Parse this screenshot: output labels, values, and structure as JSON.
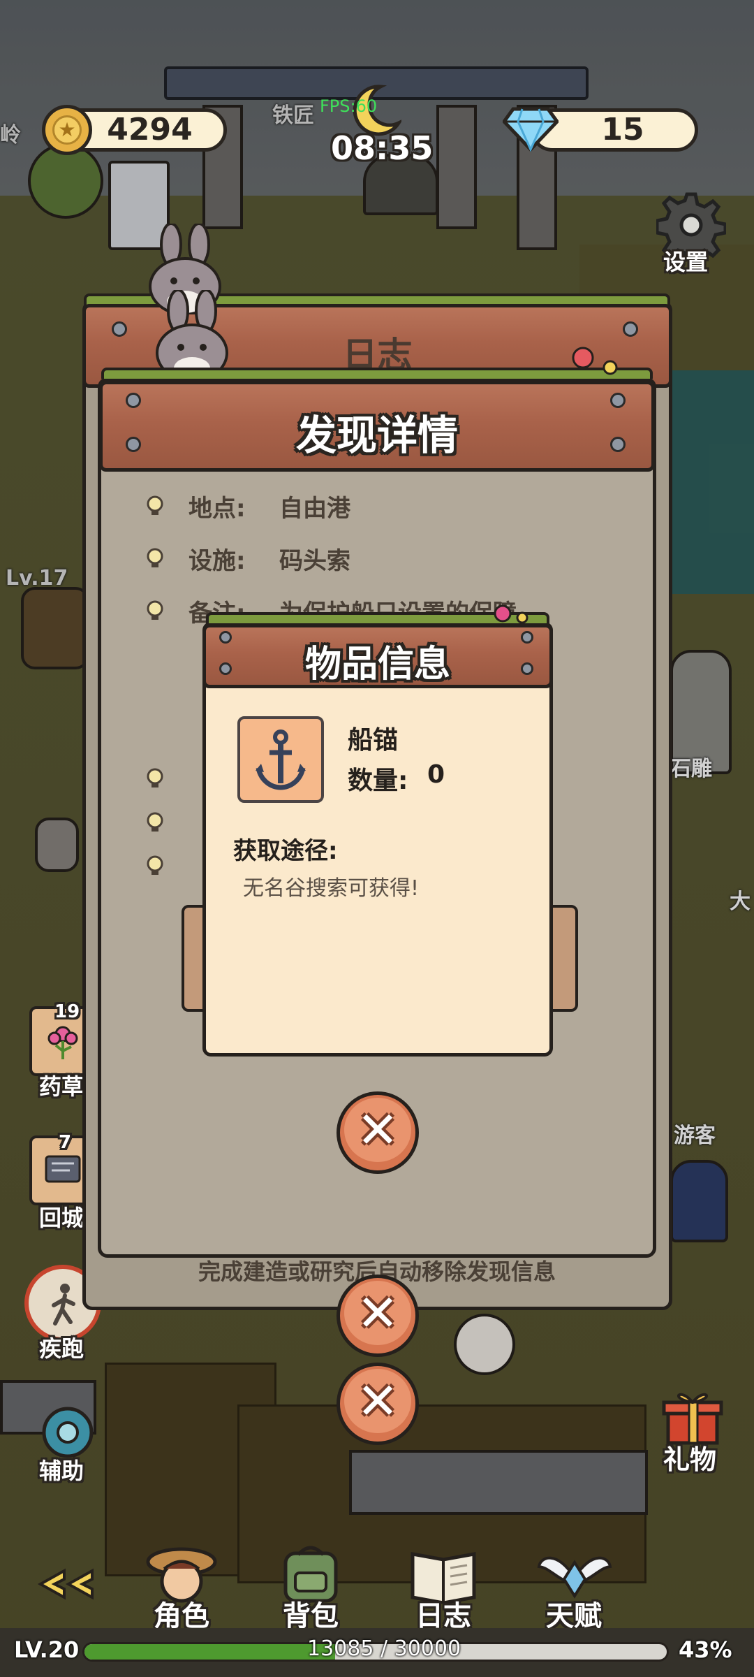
{
  "hud": {
    "coins": "4294",
    "gems": "15",
    "time": "08:35",
    "fps": "FPS:60",
    "settings_label": "设置"
  },
  "world_labels": {
    "blacksmith": "铁匠",
    "ridge": "岭",
    "statue": "石雕",
    "tourist": "游客",
    "big": "大",
    "level_label": "Lv.17"
  },
  "left_side": {
    "herb_count": "19",
    "herb_label": "药草",
    "return_count": "7",
    "return_label": "回城",
    "run_label": "疾跑",
    "assist_label": "辅助"
  },
  "right_side": {
    "gift_label": "礼物"
  },
  "journal_panel": {
    "title": "日志"
  },
  "discovery_panel": {
    "title": "发现详情",
    "rows": [
      {
        "label": "地点:",
        "value": "自由港"
      },
      {
        "label": "设施:",
        "value": "码头索"
      },
      {
        "label": "备注:",
        "value": "为保护船只设置的保障"
      }
    ],
    "footer": "完成建造或研究后自动移除发现信息"
  },
  "item_modal": {
    "title": "物品信息",
    "item_name": "船锚",
    "quantity_label": "数量:",
    "quantity_value": "0",
    "source_label": "获取途径:",
    "source_text": "无名谷搜索可获得!",
    "icon": "anchor-icon"
  },
  "bottom_nav": {
    "items": [
      {
        "label": "角色",
        "icon": "character-icon"
      },
      {
        "label": "背包",
        "icon": "backpack-icon"
      },
      {
        "label": "日志",
        "icon": "journal-book-icon"
      },
      {
        "label": "天赋",
        "icon": "talent-wings-icon"
      }
    ],
    "back_icon": "double-chevron-left-icon"
  },
  "xp_bar": {
    "level": "LV.20",
    "progress_text": "13085 / 30000",
    "percent_text": "43%",
    "progress": 0.43
  },
  "colors": {
    "plank": "#a9624a",
    "panel": "#a59c8c",
    "modal": "#fbe9cc",
    "xp_fill": "#4e9a2f"
  }
}
